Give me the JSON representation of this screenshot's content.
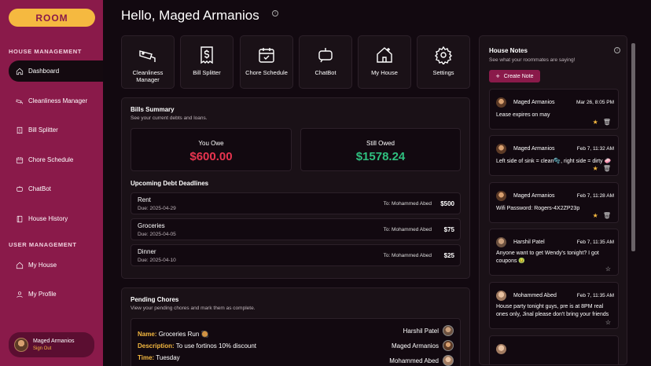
{
  "app": {
    "logo": "ROOM"
  },
  "sidebar": {
    "house_section": "HOUSE MANAGEMENT",
    "user_section": "USER MANAGEMENT",
    "items": [
      {
        "label": "Dashboard"
      },
      {
        "label": "Cleanliness Manager"
      },
      {
        "label": "Bill Splitter"
      },
      {
        "label": "Chore Schedule"
      },
      {
        "label": "ChatBot"
      },
      {
        "label": "House History"
      },
      {
        "label": "My House"
      },
      {
        "label": "My Profile"
      }
    ],
    "profile": {
      "name": "Maged Armanios",
      "signout": "Sign Out"
    }
  },
  "header": {
    "greeting": "Hello, Maged Armanios"
  },
  "tiles": [
    {
      "label": "Cleanliness Manager"
    },
    {
      "label": "Bill Splitter"
    },
    {
      "label": "Chore Schedule"
    },
    {
      "label": "ChatBot"
    },
    {
      "label": "My House"
    },
    {
      "label": "Settings"
    }
  ],
  "bills": {
    "title": "Bills Summary",
    "subtitle": "See your current debts and loans.",
    "you_owe_label": "You Owe",
    "you_owe_value": "$600.00",
    "still_owed_label": "Still Owed",
    "still_owed_value": "$1578.24",
    "deadlines_title": "Upcoming Debt Deadlines",
    "debts": [
      {
        "name": "Rent",
        "due": "Due: 2025-04-29",
        "to": "To: Mohammed Abed",
        "amount": "$500"
      },
      {
        "name": "Groceries",
        "due": "Due: 2025-04-05",
        "to": "To: Mohammed Abed",
        "amount": "$75"
      },
      {
        "name": "Dinner",
        "due": "Due: 2025-04-10",
        "to": "To: Mohammed Abed",
        "amount": "$25"
      }
    ]
  },
  "chores": {
    "title": "Pending Chores",
    "subtitle": "View your pending chores and mark them as complete.",
    "name_key": "Name:",
    "name_val": "Groceries Run 🥘",
    "desc_key": "Description:",
    "desc_val": "To use fortinos 10% discount",
    "time_key": "Time:",
    "time_val": "Tuesday",
    "assignees": [
      "Harshil Patel",
      "Maged Armanios",
      "Mohammed Abed"
    ]
  },
  "notes": {
    "title": "House Notes",
    "subtitle": "See what your roommates are saying!",
    "create_label": "Create Note",
    "items": [
      {
        "author": "Maged Armanios",
        "date": "Mar 26, 8:05 PM",
        "body": "Lease expires on may",
        "starred": true
      },
      {
        "author": "Maged Armanios",
        "date": "Feb 7, 11:32 AM",
        "body": "Left side of sink = clean🫧, right side = dirty 🧼",
        "starred": true
      },
      {
        "author": "Maged Armanios",
        "date": "Feb 7, 11:28 AM",
        "body": "Wifi Password: Rogers-4X2ZP23p",
        "starred": true
      },
      {
        "author": "Harshil Patel",
        "date": "Feb 7, 11:35 AM",
        "body": "Anyone want to get Wendy's tonight? I got coupons 🤢",
        "starred": false
      },
      {
        "author": "Mohammed Abed",
        "date": "Feb 7, 11:35 AM",
        "body": "House party tonight guys, pre is at 8PM real ones only, Jinal please don't bring your friends",
        "starred": false
      }
    ]
  },
  "colors": {
    "accent": "#8a1a4a",
    "gold": "#f5b940",
    "owe": "#e8344f",
    "owed": "#2fbf7f"
  }
}
